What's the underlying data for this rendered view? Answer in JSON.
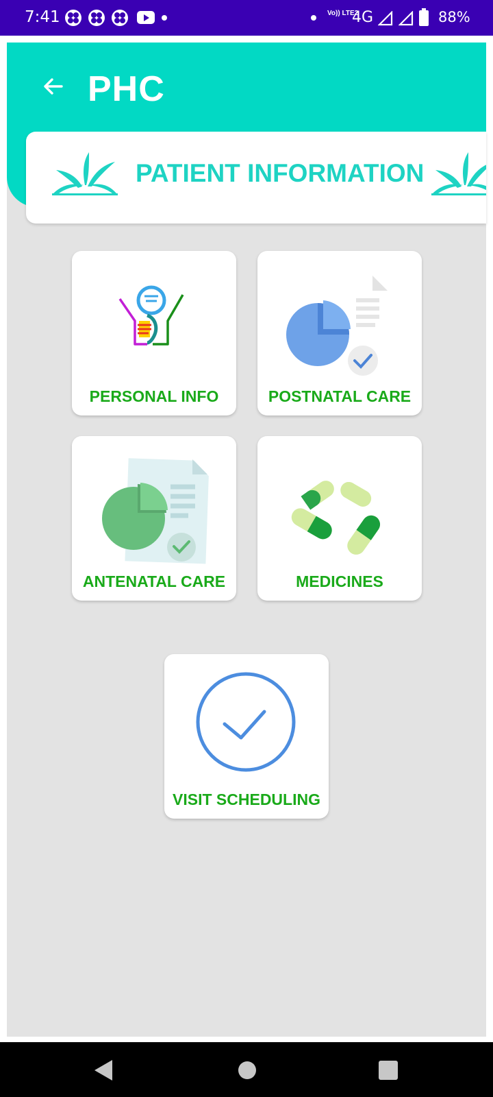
{
  "status_bar": {
    "time": "7:41",
    "network": "4G",
    "volte": "Vo)) LTE2",
    "battery": "88%"
  },
  "header": {
    "title": "PHC",
    "back_icon": "arrow-left-icon",
    "accent_color": "#02d9c4"
  },
  "banner": {
    "title": "PATIENT INFORMATION",
    "title_color": "#1ed3c3"
  },
  "tiles": [
    {
      "label": "PERSONAL INFO",
      "icon": "person-info-icon"
    },
    {
      "label": "POSTNATAL CARE",
      "icon": "pie-chart-report-icon"
    },
    {
      "label": "ANTENATAL CARE",
      "icon": "pie-chart-document-icon"
    },
    {
      "label": "MEDICINES",
      "icon": "capsules-icon"
    },
    {
      "label": "VISIT SCHEDULING",
      "icon": "check-circle-icon"
    }
  ],
  "colors": {
    "tile_label": "#1aaa1a",
    "status_bar": "#3a00b3",
    "background": "#e3e3e3"
  }
}
